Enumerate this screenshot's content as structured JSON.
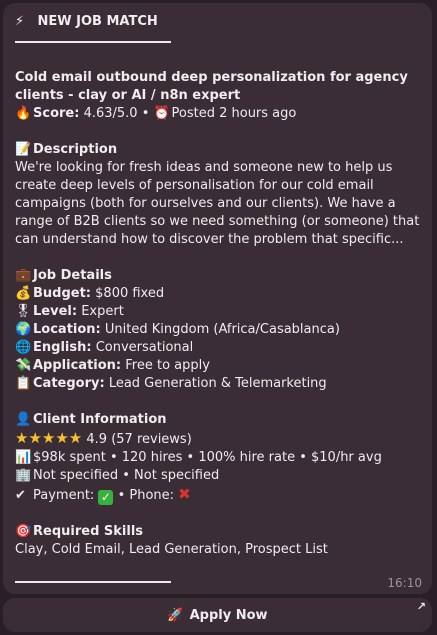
{
  "header": {
    "icon": "⚡",
    "title": "NEW JOB MATCH"
  },
  "job": {
    "title": "Cold email outbound deep personalization for agency clients - clay or AI / n8n expert",
    "score_label": "Score:",
    "score_value": "4.63/5.0",
    "posted": "Posted 2 hours ago"
  },
  "description": {
    "heading": "Description",
    "text": "We're looking for fresh ideas and someone new to help us create deep levels of personalisation for our cold email campaigns (both for ourselves and our clients). We have a range of B2B clients so we need something (or someone) that can understand how to discover the problem that specific..."
  },
  "job_details": {
    "heading": "Job Details",
    "items": [
      {
        "icon": "💰",
        "label": "Budget:",
        "value": "$800 fixed"
      },
      {
        "icon": "🎖",
        "label": "Level:",
        "value": "Expert"
      },
      {
        "icon": "🌍",
        "label": "Location:",
        "value": "United Kingdom (Africa/Casablanca)"
      },
      {
        "icon": "🌐",
        "label": "English:",
        "value": "Conversational"
      },
      {
        "icon": "💸",
        "label": "Application:",
        "value": "Free to apply"
      },
      {
        "icon": "📋",
        "label": "Category:",
        "value": "Lead Generation & Telemarketing"
      }
    ]
  },
  "client": {
    "heading": "Client Information",
    "rating": "4.9 (57 reviews)",
    "stats": "$98k spent • 120 hires • 100% hire rate • $10/hr avg",
    "location": "Not specified • Not specified",
    "payment_label": "Payment:",
    "phone_label": "• Phone:"
  },
  "skills": {
    "heading": "Required Skills",
    "text": "Clay, Cold Email, Lead Generation, Prospect List"
  },
  "time": "16:10",
  "button": {
    "label": "Apply Now"
  }
}
